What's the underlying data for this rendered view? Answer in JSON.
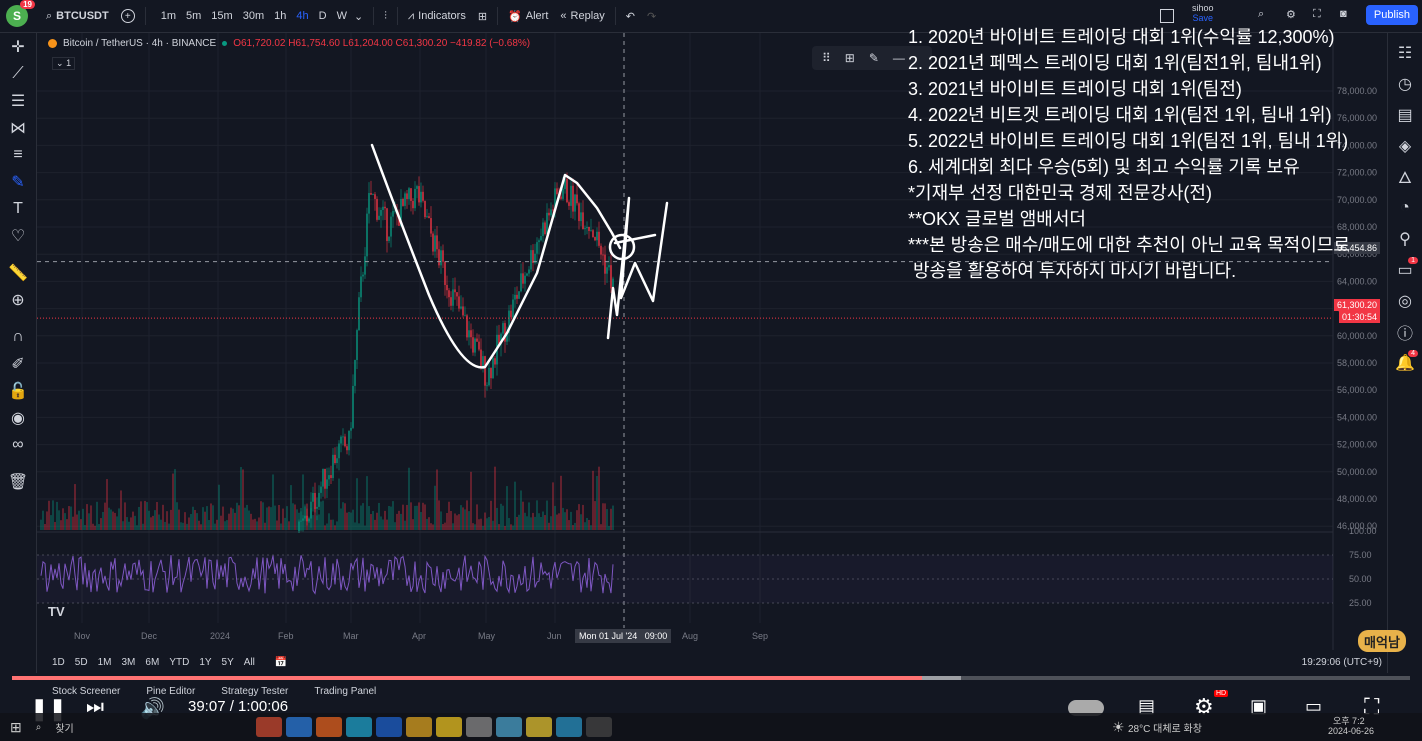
{
  "topbar": {
    "avatar_letter": "S",
    "avatar_badge": "19",
    "symbol": "BTCUSDT",
    "timeframes": [
      "1m",
      "5m",
      "15m",
      "30m",
      "1h",
      "4h",
      "D",
      "W"
    ],
    "active_timeframe": "4h",
    "indicators_label": "Indicators",
    "alert_label": "Alert",
    "replay_label": "Replay",
    "user_name": "sihoo",
    "save_label": "Save",
    "publish_label": "Publish"
  },
  "legend": {
    "title": "Bitcoin / TetherUS · 4h · BINANCE",
    "ohlc": "O61,720.02 H61,754.60 L61,204.00 C61,300.20 −419.82 (−0.68%)",
    "indicator_count": "1"
  },
  "price_axis": [
    "78,000.00",
    "76,000.00",
    "74,000.00",
    "72,000.00",
    "70,000.00",
    "68,000.00",
    "66,000.00",
    "64,000.00",
    "62,000.00",
    "60,000.00",
    "58,000.00",
    "56,000.00",
    "54,000.00",
    "52,000.00",
    "50,000.00",
    "48,000.00",
    "46,000.00"
  ],
  "crosshair_price": "65,454.86",
  "last_price": "61,300.20",
  "countdown": "01:30:54",
  "rsi_axis": [
    "100.00",
    "75.00",
    "50.00",
    "25.00"
  ],
  "time_axis": [
    "Nov",
    "Dec",
    "2024",
    "Feb",
    "Mar",
    "Apr",
    "May",
    "Jun",
    "Aug",
    "Sep"
  ],
  "crosshair_time": "Mon 01 Jul '24   09:00",
  "range_buttons": [
    "1D",
    "5D",
    "1M",
    "3M",
    "6M",
    "YTD",
    "1Y",
    "5Y",
    "All"
  ],
  "clock": "19:29:06 (UTC+9)",
  "overlay_lines": [
    "1. 2020년 바이비트 트레이딩 대회 1위(수익률 12,300%)",
    "2. 2021년 페멕스 트레이딩 대회 1위(팀전1위, 팀내1위)",
    "3. 2021년 바이비트 트레이딩 대회 1위(팀전)",
    "4. 2022년 비트겟 트레이딩 대회 1위(팀전 1위, 팀내 1위)",
    "5. 2022년 바이비트 트레이딩 대회 1위(팀전 1위, 팀내 1위)",
    "6. 세계대회 최다 우승(5회) 및 최고 수익률 기록 보유",
    "*기재부 선정 대한민국 경제 전문강사(전)",
    "**OKX 글로벌 앰배서더",
    "***본 방송은 매수/매도에 대한 추천이 아닌 교육 목적이므로",
    " 방송을 활용하여 투자하지 마시기 바랍니다."
  ],
  "tv_tabs": [
    "Stock Screener",
    "Pine Editor",
    "Strategy Tester",
    "Trading Panel"
  ],
  "video": {
    "time": "39:07 / 1:00:06",
    "progress": 0.651,
    "buffered": 0.679,
    "hd_badge": "HD"
  },
  "watermark": "매억남",
  "taskbar": {
    "search": "찾기",
    "weather": "28°C 대체로 화창",
    "date": "2024-06-26",
    "time_short": "오후 7:2"
  },
  "colors": {
    "up": "#089981",
    "down": "#f23645",
    "accent": "#2962ff",
    "rsi": "#7e57c2"
  }
}
